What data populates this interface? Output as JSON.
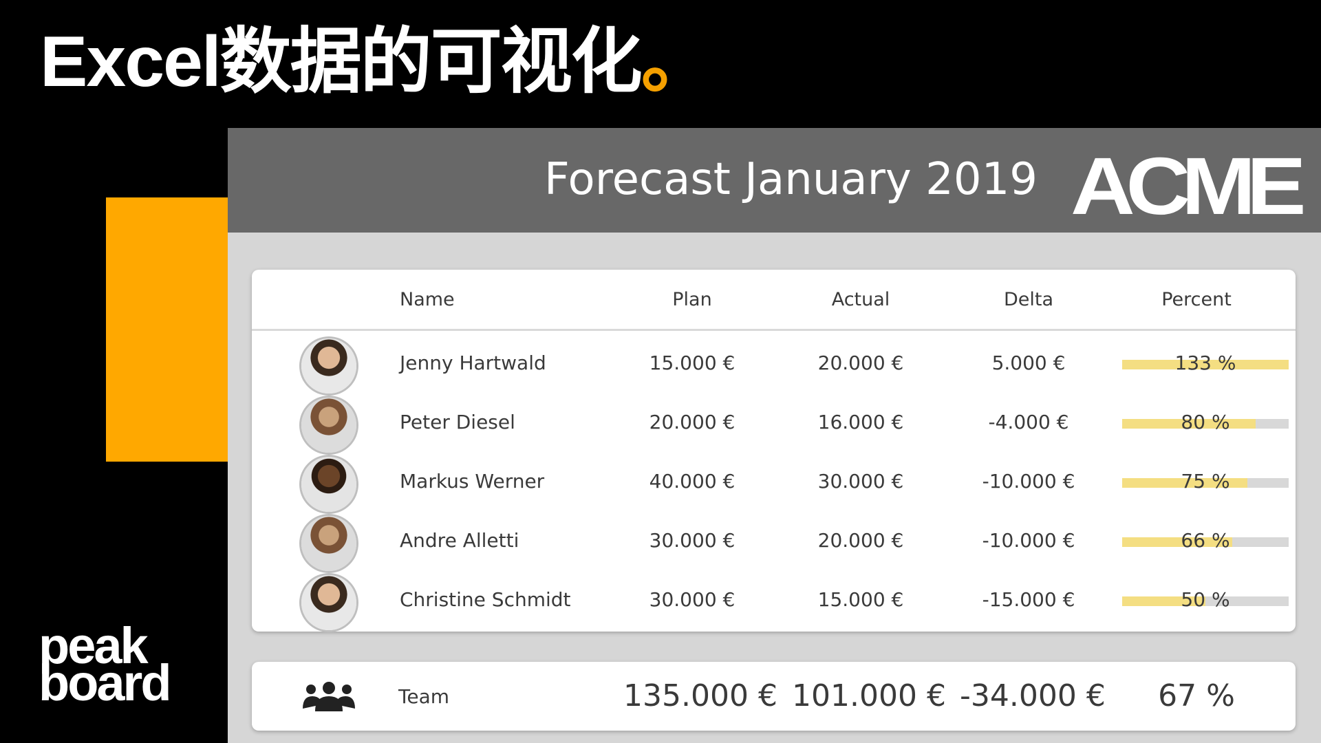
{
  "slide": {
    "headline": "Excel数据的可视化",
    "headline_dot": "。",
    "brand_line1": "peak",
    "brand_line2": "board",
    "accent_color": "#ffa800"
  },
  "dashboard": {
    "title": "Forecast January 2019",
    "logo_text": "ACME",
    "columns": [
      "Name",
      "Plan",
      "Actual",
      "Delta",
      "Percent"
    ],
    "rows": [
      {
        "name": "Jenny Hartwald",
        "plan": "15.000 €",
        "actual": "20.000 €",
        "delta": "5.000 €",
        "percent_label": "133 %",
        "percent": 1.33
      },
      {
        "name": "Peter Diesel",
        "plan": "20.000 €",
        "actual": "16.000 €",
        "delta": "-4.000 €",
        "percent_label": "80 %",
        "percent": 0.8
      },
      {
        "name": "Markus Werner",
        "plan": "40.000 €",
        "actual": "30.000 €",
        "delta": "-10.000 €",
        "percent_label": "75 %",
        "percent": 0.75
      },
      {
        "name": "Andre Alletti",
        "plan": "30.000 €",
        "actual": "20.000 €",
        "delta": "-10.000 €",
        "percent_label": "66 %",
        "percent": 0.66
      },
      {
        "name": "Christine Schmidt",
        "plan": "30.000 €",
        "actual": "15.000 €",
        "delta": "-15.000 €",
        "percent_label": "50 %",
        "percent": 0.5
      }
    ],
    "team": {
      "icon": "team-icon",
      "label": "Team",
      "plan": "135.000 €",
      "actual": "101.000 €",
      "delta": "-34.000 €",
      "percent": "67 %"
    },
    "bar_color": "#f4de82",
    "header_color": "#686868"
  }
}
